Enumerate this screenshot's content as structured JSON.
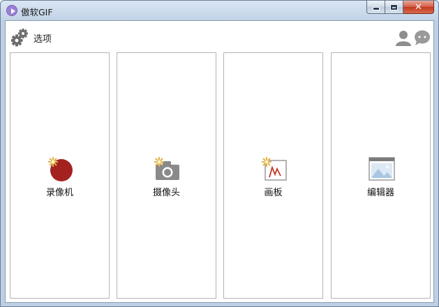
{
  "window": {
    "title": "傲软GIF",
    "controls": {
      "minimize": "minimize",
      "maximize": "maximize",
      "close": "✕"
    }
  },
  "header": {
    "options_label": "选项",
    "icons": {
      "options": "gear-icon",
      "account": "user-icon",
      "feedback": "chat-icon"
    }
  },
  "tiles": [
    {
      "label": "录像机",
      "icon": "record-icon"
    },
    {
      "label": "摄像头",
      "icon": "camera-icon"
    },
    {
      "label": "画板",
      "icon": "sketchboard-icon"
    },
    {
      "label": "编辑器",
      "icon": "editor-icon"
    }
  ],
  "colors": {
    "record_red": "#a3221f",
    "sparkle_gold": "#e2b24a",
    "icon_gray": "#8a8a8a",
    "editor_blue": "#bcd3e8"
  }
}
